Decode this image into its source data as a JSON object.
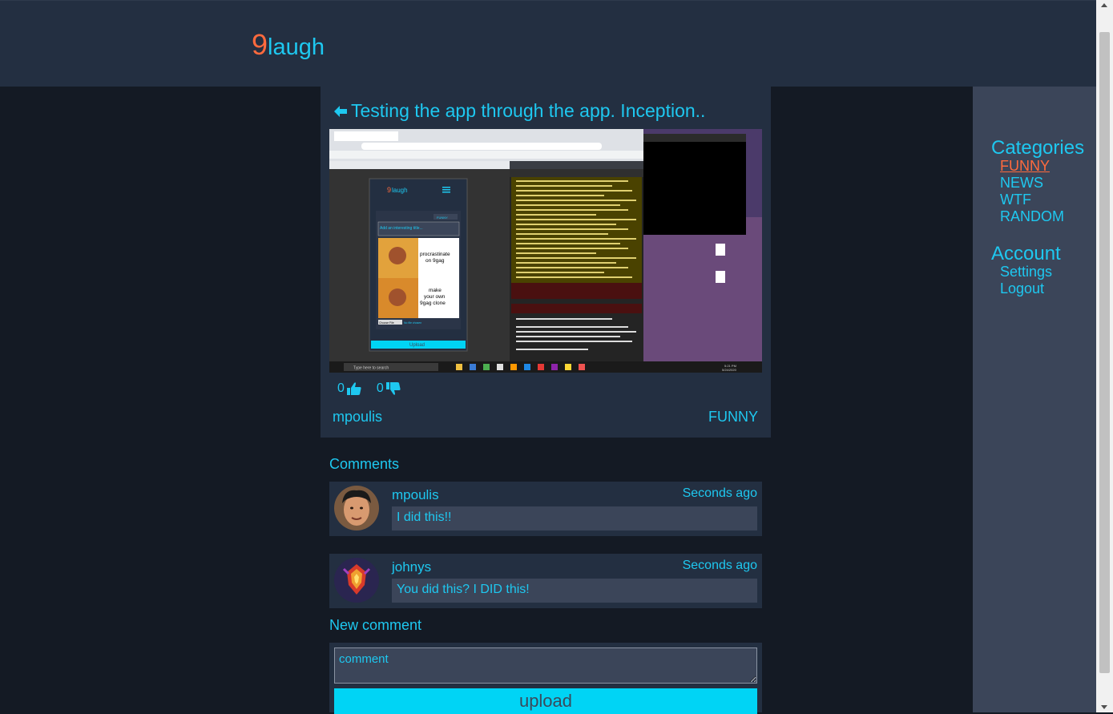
{
  "header": {
    "logo_num": "9",
    "logo_word": "laugh"
  },
  "post": {
    "title": "Testing the app through the app. Inception..",
    "likes": "0",
    "dislikes": "0",
    "author": "mpoulis",
    "category": "FUNNY",
    "image": {
      "mini_logo_num": "9",
      "mini_logo_word": "laugh",
      "mini_input_placeholder": "Add an interesting title...",
      "meme_top": "procrastinate on 9gag",
      "meme_bottom": "make your own 9gag clone",
      "mini_choose": "Choose File",
      "mini_nofile": "No file chosen",
      "mini_upload": "Upload",
      "mini_select": "FUNNY",
      "search_text": "Type here to search",
      "clock": "5:21 PM",
      "date": "5/24/2020"
    }
  },
  "comments_label": "Comments",
  "comments": [
    {
      "user": "mpoulis",
      "time": "Seconds ago",
      "text": "I did this!!"
    },
    {
      "user": "johnys",
      "time": "Seconds ago",
      "text": "You did this? I DID this!"
    }
  ],
  "new_comment": {
    "label": "New comment",
    "placeholder": "comment",
    "button": "upload"
  },
  "sidebar": {
    "categories_title": "Categories",
    "categories": [
      {
        "label": "FUNNY",
        "active": true
      },
      {
        "label": "NEWS"
      },
      {
        "label": "WTF"
      },
      {
        "label": "RANDOM"
      }
    ],
    "account_title": "Account",
    "account": [
      {
        "label": "Settings"
      },
      {
        "label": "Logout"
      }
    ]
  },
  "colors": {
    "accent": "#1ec8f0",
    "brand_orange": "#ff6a3d",
    "header_bg": "#232f41",
    "page_bg": "#141a24",
    "sidebar_bg": "#3b4559",
    "button_bg": "#00d4f5"
  }
}
